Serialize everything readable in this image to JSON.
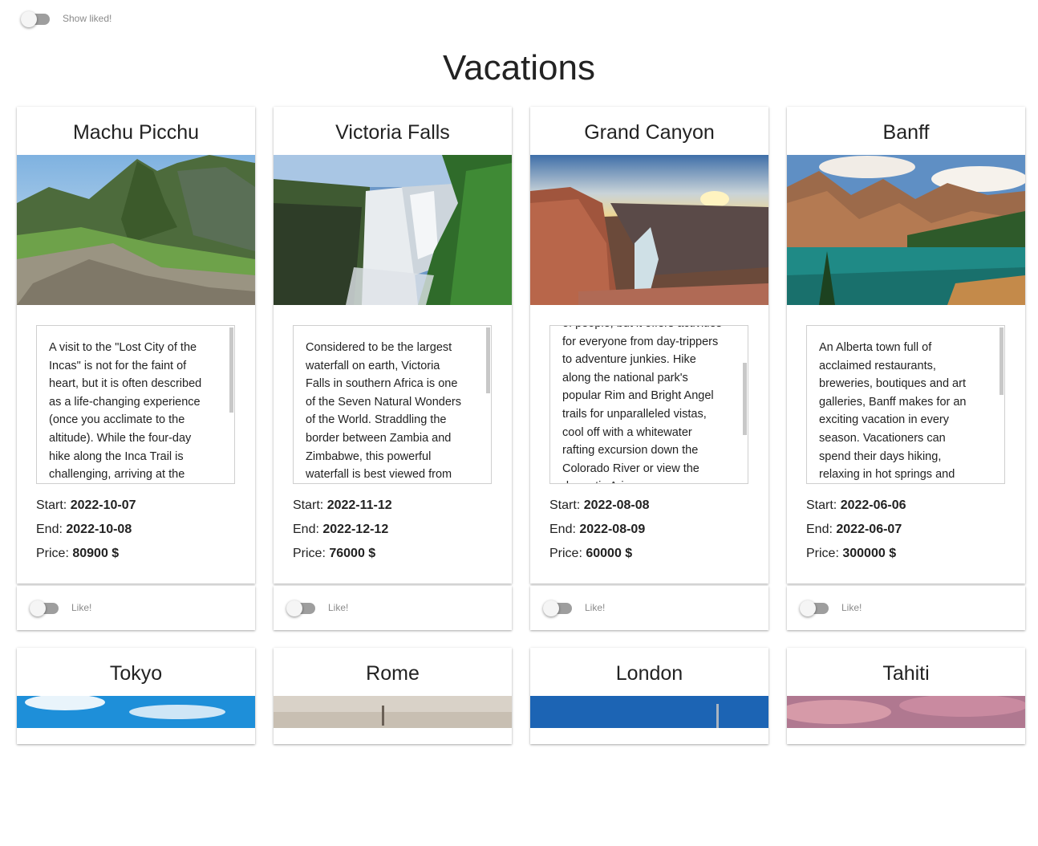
{
  "header": {
    "show_liked_label": "Show liked!",
    "page_title": "Vacations"
  },
  "labels": {
    "start": "Start:",
    "end": "End:",
    "price": "Price:",
    "like": "Like!"
  },
  "vacations": [
    {
      "title": "Machu Picchu",
      "description": "A visit to the \"Lost City of the Incas\" is not for the faint of heart, but it is often described as a life-changing experience (once you acclimate to the altitude). While the four-day hike along the Inca Trail is challenging, arriving at the",
      "start": "2022-10-07",
      "end": "2022-10-08",
      "price": "80900 $"
    },
    {
      "title": "Victoria Falls",
      "description": "Considered to be the largest waterfall on earth, Victoria Falls in southern Africa is one of the Seven Natural Wonders of the World. Straddling the border between Zambia and Zimbabwe, this powerful waterfall is best viewed from",
      "start": "2022-11-12",
      "end": "2022-12-12",
      "price": "76000 $"
    },
    {
      "title": "Grand Canyon",
      "description": "of people, but it offers activities for everyone from day-trippers to adventure junkies. Hike along the national park's popular Rim and Bright Angel trails for unparalleled vistas, cool off with a whitewater rafting excursion down the Colorado River or view the dramatic Arizona",
      "start": "2022-08-08",
      "end": "2022-08-09",
      "price": "60000 $"
    },
    {
      "title": "Banff",
      "description": "An Alberta town full of acclaimed restaurants, breweries, boutiques and art galleries, Banff makes for an exciting vacation in every season. Vacationers can spend their days hiking, relaxing in hot springs and boating on scenic",
      "start": "2022-06-06",
      "end": "2022-06-07",
      "price": "300000 $"
    },
    {
      "title": "Tokyo"
    },
    {
      "title": "Rome"
    },
    {
      "title": "London"
    },
    {
      "title": "Tahiti"
    }
  ]
}
